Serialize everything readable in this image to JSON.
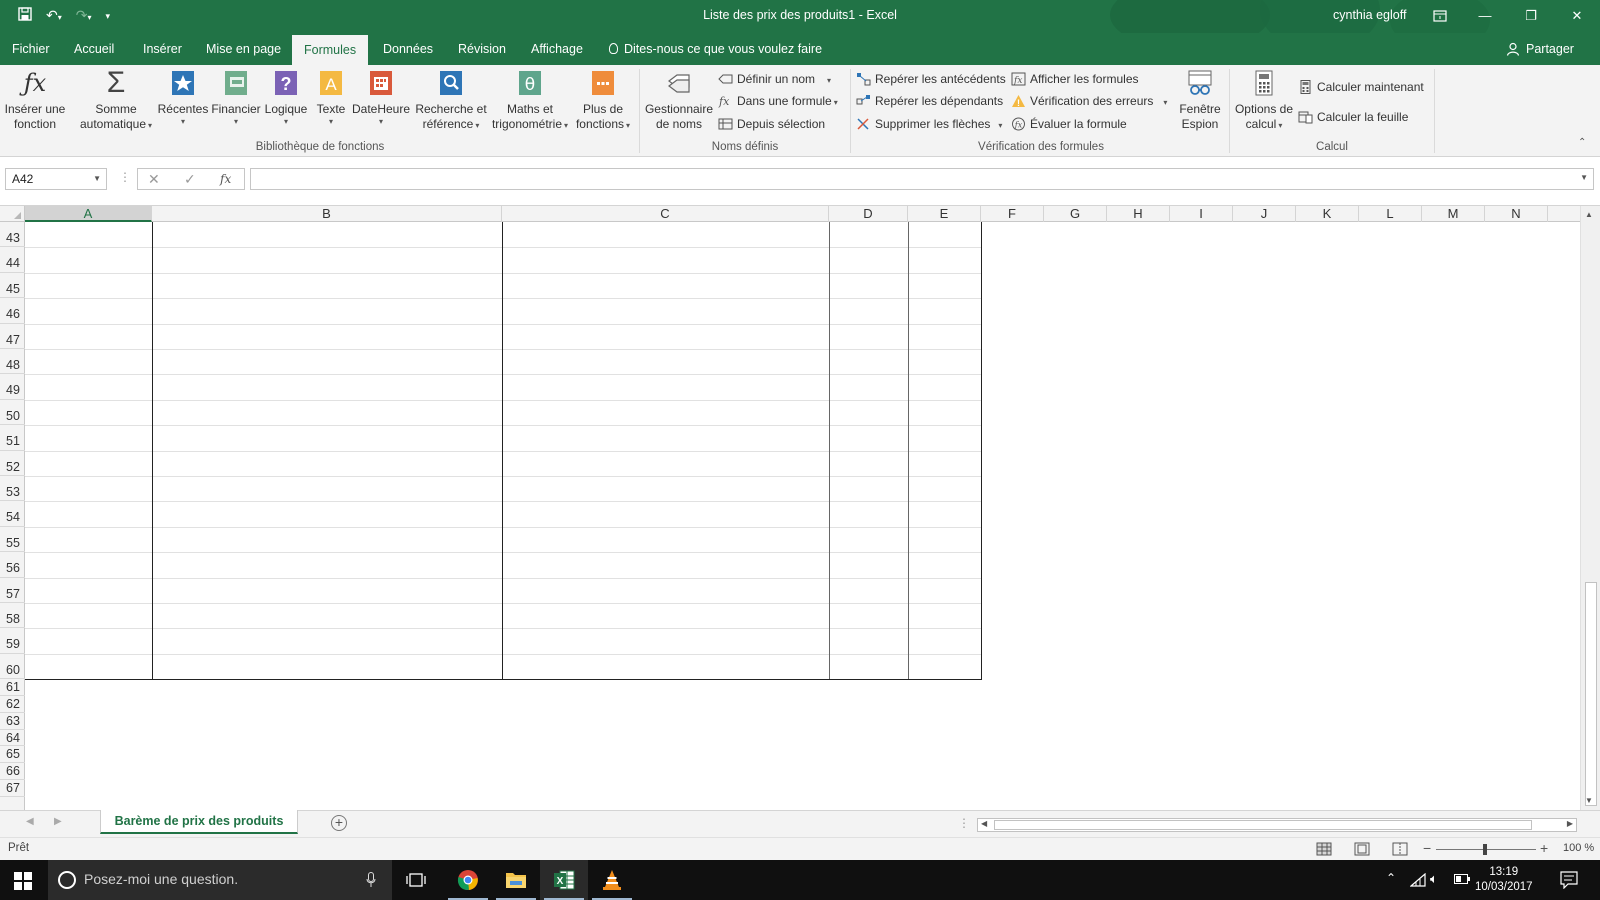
{
  "window": {
    "title": "Liste des prix des produits1  -  Excel",
    "user": "cynthia egloff"
  },
  "tabs": [
    "Fichier",
    "Accueil",
    "Insérer",
    "Mise en page",
    "Formules",
    "Données",
    "Révision",
    "Affichage"
  ],
  "active_tab": "Formules",
  "tell_me": "Dites-nous ce que vous voulez faire",
  "share": "Partager",
  "ribbon": {
    "groups": {
      "function_library": "Bibliothèque de fonctions",
      "defined_names": "Noms définis",
      "formula_auditing": "Vérification des formules",
      "calculation": "Calcul"
    },
    "insert_function": [
      "Insérer une",
      "fonction"
    ],
    "autosum": [
      "Somme",
      "automatique"
    ],
    "recent": "Récentes",
    "financial": "Financier",
    "logical": "Logique",
    "text": "Texte",
    "datetime": "DateHeure",
    "lookup": [
      "Recherche et",
      "référence"
    ],
    "math": [
      "Maths et",
      "trigonométrie"
    ],
    "more_functions": [
      "Plus de",
      "fonctions"
    ],
    "name_manager": [
      "Gestionnaire",
      "de noms"
    ],
    "define_name": "Définir un nom",
    "use_in_formula": "Dans une formule",
    "create_from_selection": "Depuis sélection",
    "trace_precedents": "Repérer les antécédents",
    "trace_dependents": "Repérer les dépendants",
    "remove_arrows": "Supprimer les flèches",
    "show_formulas": "Afficher les formules",
    "error_checking": "Vérification des erreurs",
    "evaluate_formula": "Évaluer la formule",
    "watch_window": [
      "Fenêtre",
      "Espion"
    ],
    "calc_options": [
      "Options de",
      "calcul"
    ],
    "calc_now": "Calculer maintenant",
    "calc_sheet": "Calculer la feuille"
  },
  "formula_bar": {
    "name_box": "A42",
    "cancel_glyph": "✕",
    "enter_glyph": "✓",
    "fx_glyph": "fx",
    "value": ""
  },
  "columns": [
    "A",
    "B",
    "C",
    "D",
    "E",
    "F",
    "G",
    "H",
    "I",
    "J",
    "K",
    "L",
    "M",
    "N"
  ],
  "selected_column": "A",
  "rows": [
    "43",
    "44",
    "45",
    "46",
    "47",
    "48",
    "49",
    "50",
    "51",
    "52",
    "53",
    "54",
    "55",
    "56",
    "57",
    "58",
    "59",
    "60",
    "61",
    "62",
    "63",
    "64",
    "65",
    "66",
    "67"
  ],
  "sheets": [
    "Barème de prix des produits"
  ],
  "status": {
    "ready": "Prêt",
    "zoom": "100 %"
  },
  "taskbar": {
    "search_placeholder": "Posez-moi une question.",
    "time": "13:19",
    "date": "10/03/2017"
  },
  "colors": {
    "excel_green": "#217346",
    "table_border": "#222222"
  }
}
